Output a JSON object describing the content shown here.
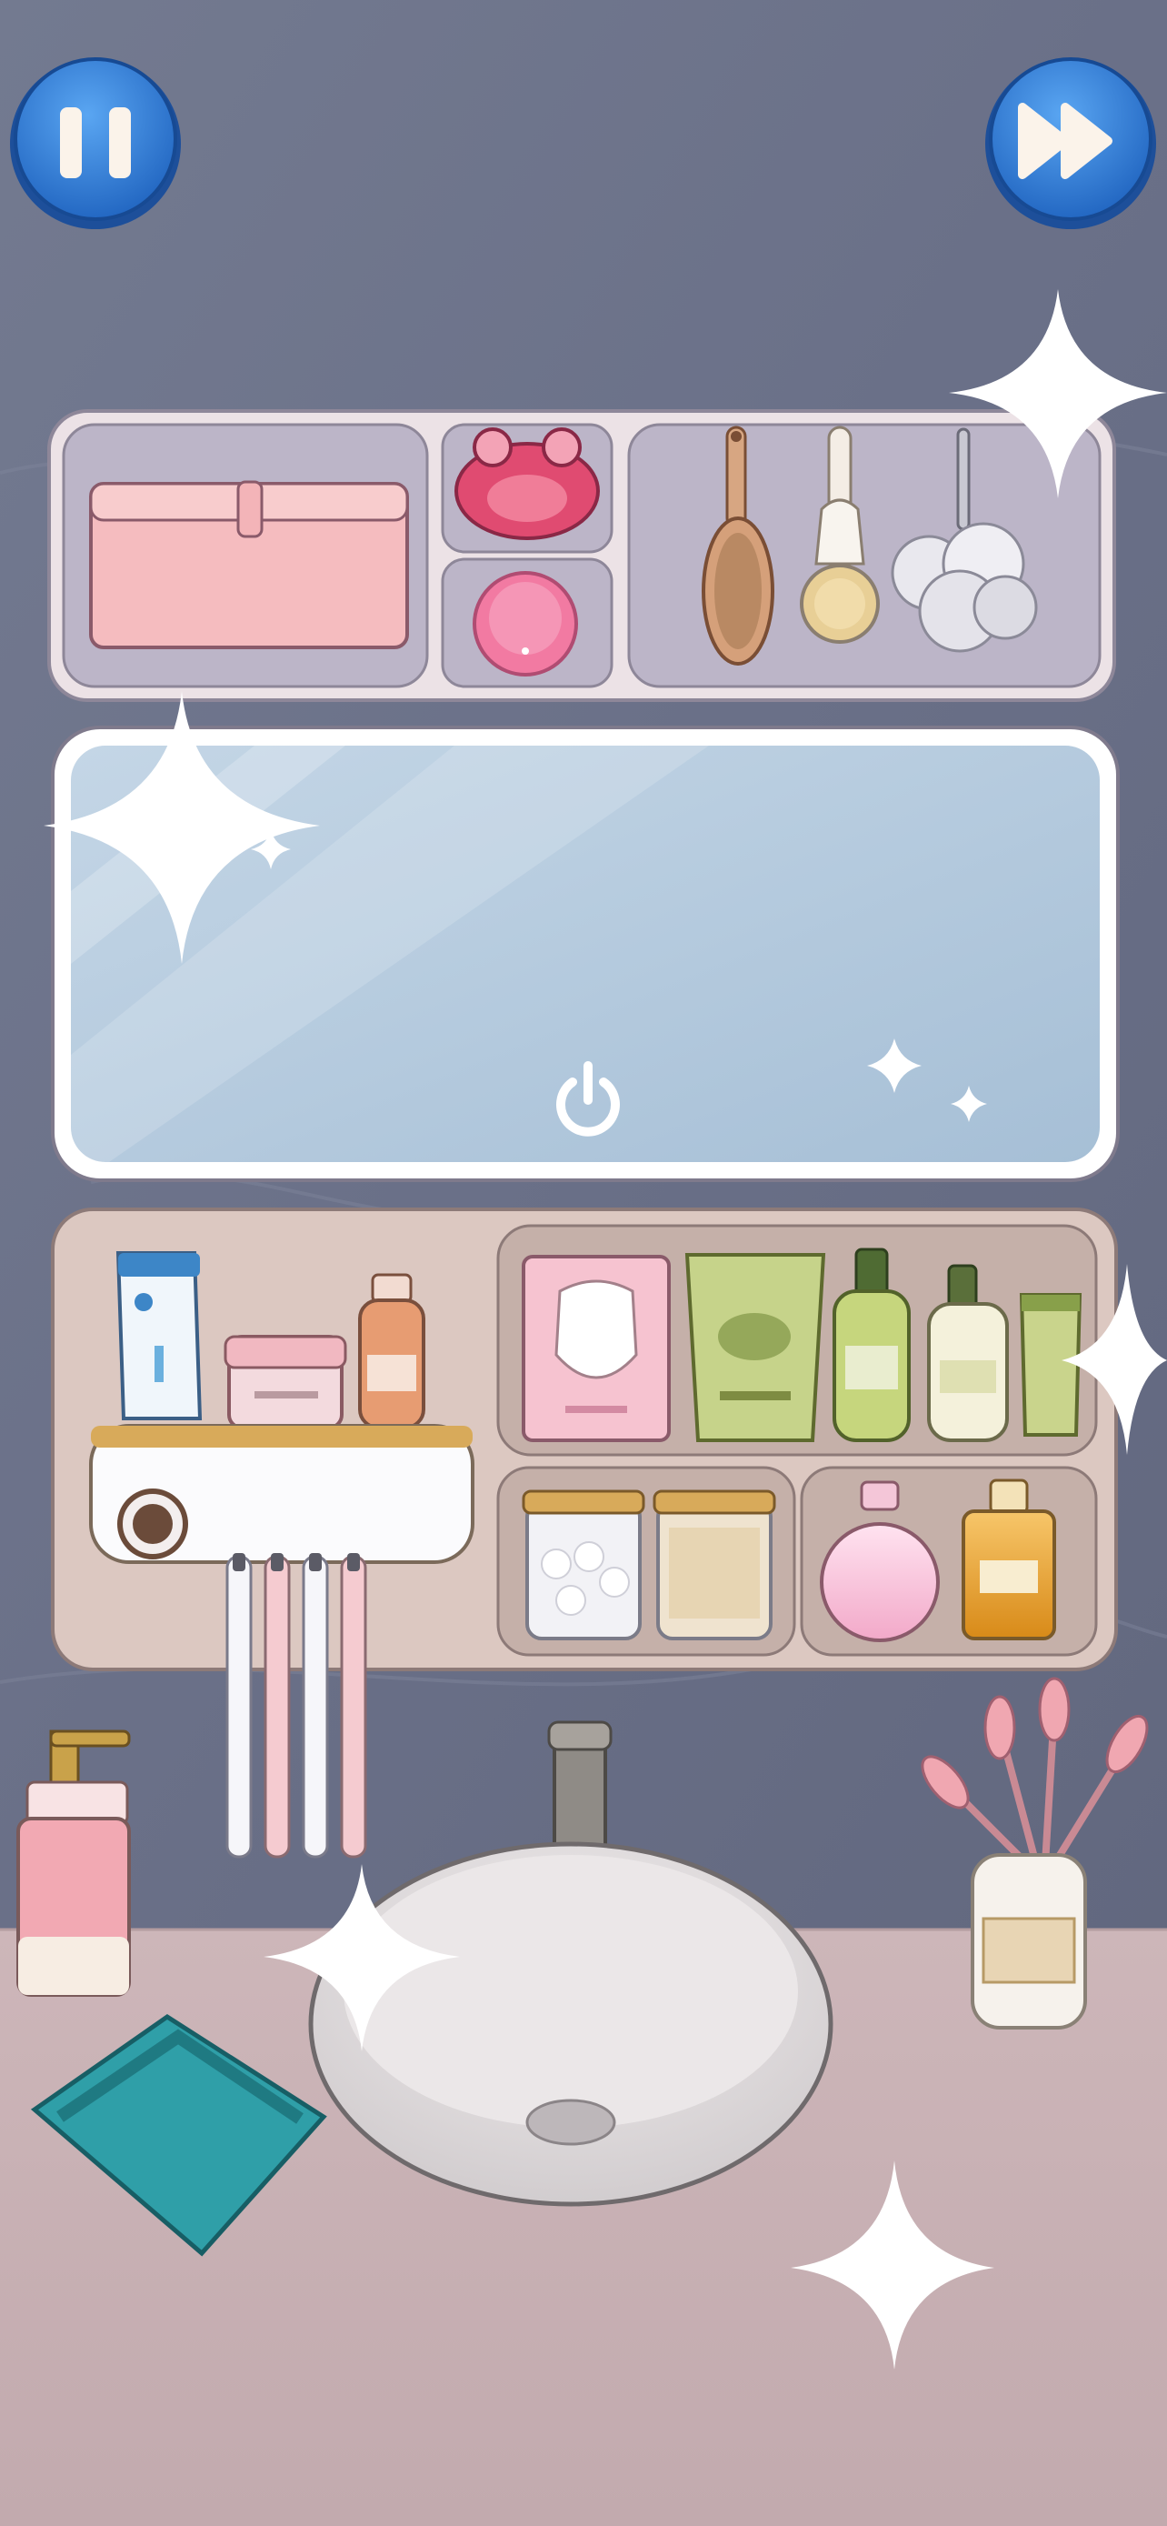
{
  "hud": {
    "pause_icon": "pause-icon",
    "skip_icon": "fast-forward-icon"
  },
  "colors": {
    "wall": "#6e748a",
    "counter": "#c9b3b6",
    "button_blue": "#2f7fd6",
    "mirror": "#b2c8dc",
    "shelf_top": "#bdb6c9",
    "shelf_bottom": "#d8c4bd"
  },
  "items": {
    "top_shelf": [
      "pink-storage-box",
      "frog-face-massager",
      "facial-cleansing-brush",
      "wooden-hair-brush",
      "bath-brush",
      "bath-loofah"
    ],
    "mirror": [
      "mirror-power-icon"
    ],
    "bottom_shelf": [
      "toothpaste",
      "face-cream-jar",
      "serum-bottle",
      "toothpaste-dispenser",
      "electric-toothbrushes",
      "sheet-mask",
      "olive-refill-pouch",
      "olive-pump-bottle",
      "olive-lotion-bottle",
      "olive-tube",
      "cotton-balls-jar",
      "cotton-swabs-jar",
      "pink-perfume",
      "amber-perfume"
    ],
    "counter": [
      "soap-dispenser",
      "basin-faucet",
      "sink-basin",
      "teal-towel",
      "flower-vase"
    ]
  }
}
